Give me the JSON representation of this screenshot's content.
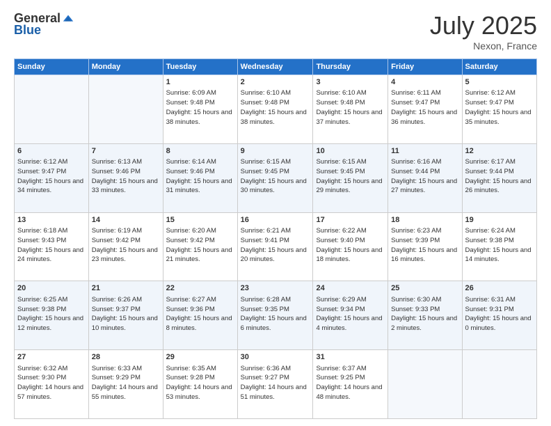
{
  "header": {
    "logo_general": "General",
    "logo_blue": "Blue",
    "month_year": "July 2025",
    "location": "Nexon, France"
  },
  "weekdays": [
    "Sunday",
    "Monday",
    "Tuesday",
    "Wednesday",
    "Thursday",
    "Friday",
    "Saturday"
  ],
  "weeks": [
    [
      {
        "day": "",
        "sunrise": "",
        "sunset": "",
        "daylight": ""
      },
      {
        "day": "",
        "sunrise": "",
        "sunset": "",
        "daylight": ""
      },
      {
        "day": "1",
        "sunrise": "Sunrise: 6:09 AM",
        "sunset": "Sunset: 9:48 PM",
        "daylight": "Daylight: 15 hours and 38 minutes."
      },
      {
        "day": "2",
        "sunrise": "Sunrise: 6:10 AM",
        "sunset": "Sunset: 9:48 PM",
        "daylight": "Daylight: 15 hours and 38 minutes."
      },
      {
        "day": "3",
        "sunrise": "Sunrise: 6:10 AM",
        "sunset": "Sunset: 9:48 PM",
        "daylight": "Daylight: 15 hours and 37 minutes."
      },
      {
        "day": "4",
        "sunrise": "Sunrise: 6:11 AM",
        "sunset": "Sunset: 9:47 PM",
        "daylight": "Daylight: 15 hours and 36 minutes."
      },
      {
        "day": "5",
        "sunrise": "Sunrise: 6:12 AM",
        "sunset": "Sunset: 9:47 PM",
        "daylight": "Daylight: 15 hours and 35 minutes."
      }
    ],
    [
      {
        "day": "6",
        "sunrise": "Sunrise: 6:12 AM",
        "sunset": "Sunset: 9:47 PM",
        "daylight": "Daylight: 15 hours and 34 minutes."
      },
      {
        "day": "7",
        "sunrise": "Sunrise: 6:13 AM",
        "sunset": "Sunset: 9:46 PM",
        "daylight": "Daylight: 15 hours and 33 minutes."
      },
      {
        "day": "8",
        "sunrise": "Sunrise: 6:14 AM",
        "sunset": "Sunset: 9:46 PM",
        "daylight": "Daylight: 15 hours and 31 minutes."
      },
      {
        "day": "9",
        "sunrise": "Sunrise: 6:15 AM",
        "sunset": "Sunset: 9:45 PM",
        "daylight": "Daylight: 15 hours and 30 minutes."
      },
      {
        "day": "10",
        "sunrise": "Sunrise: 6:15 AM",
        "sunset": "Sunset: 9:45 PM",
        "daylight": "Daylight: 15 hours and 29 minutes."
      },
      {
        "day": "11",
        "sunrise": "Sunrise: 6:16 AM",
        "sunset": "Sunset: 9:44 PM",
        "daylight": "Daylight: 15 hours and 27 minutes."
      },
      {
        "day": "12",
        "sunrise": "Sunrise: 6:17 AM",
        "sunset": "Sunset: 9:44 PM",
        "daylight": "Daylight: 15 hours and 26 minutes."
      }
    ],
    [
      {
        "day": "13",
        "sunrise": "Sunrise: 6:18 AM",
        "sunset": "Sunset: 9:43 PM",
        "daylight": "Daylight: 15 hours and 24 minutes."
      },
      {
        "day": "14",
        "sunrise": "Sunrise: 6:19 AM",
        "sunset": "Sunset: 9:42 PM",
        "daylight": "Daylight: 15 hours and 23 minutes."
      },
      {
        "day": "15",
        "sunrise": "Sunrise: 6:20 AM",
        "sunset": "Sunset: 9:42 PM",
        "daylight": "Daylight: 15 hours and 21 minutes."
      },
      {
        "day": "16",
        "sunrise": "Sunrise: 6:21 AM",
        "sunset": "Sunset: 9:41 PM",
        "daylight": "Daylight: 15 hours and 20 minutes."
      },
      {
        "day": "17",
        "sunrise": "Sunrise: 6:22 AM",
        "sunset": "Sunset: 9:40 PM",
        "daylight": "Daylight: 15 hours and 18 minutes."
      },
      {
        "day": "18",
        "sunrise": "Sunrise: 6:23 AM",
        "sunset": "Sunset: 9:39 PM",
        "daylight": "Daylight: 15 hours and 16 minutes."
      },
      {
        "day": "19",
        "sunrise": "Sunrise: 6:24 AM",
        "sunset": "Sunset: 9:38 PM",
        "daylight": "Daylight: 15 hours and 14 minutes."
      }
    ],
    [
      {
        "day": "20",
        "sunrise": "Sunrise: 6:25 AM",
        "sunset": "Sunset: 9:38 PM",
        "daylight": "Daylight: 15 hours and 12 minutes."
      },
      {
        "day": "21",
        "sunrise": "Sunrise: 6:26 AM",
        "sunset": "Sunset: 9:37 PM",
        "daylight": "Daylight: 15 hours and 10 minutes."
      },
      {
        "day": "22",
        "sunrise": "Sunrise: 6:27 AM",
        "sunset": "Sunset: 9:36 PM",
        "daylight": "Daylight: 15 hours and 8 minutes."
      },
      {
        "day": "23",
        "sunrise": "Sunrise: 6:28 AM",
        "sunset": "Sunset: 9:35 PM",
        "daylight": "Daylight: 15 hours and 6 minutes."
      },
      {
        "day": "24",
        "sunrise": "Sunrise: 6:29 AM",
        "sunset": "Sunset: 9:34 PM",
        "daylight": "Daylight: 15 hours and 4 minutes."
      },
      {
        "day": "25",
        "sunrise": "Sunrise: 6:30 AM",
        "sunset": "Sunset: 9:33 PM",
        "daylight": "Daylight: 15 hours and 2 minutes."
      },
      {
        "day": "26",
        "sunrise": "Sunrise: 6:31 AM",
        "sunset": "Sunset: 9:31 PM",
        "daylight": "Daylight: 15 hours and 0 minutes."
      }
    ],
    [
      {
        "day": "27",
        "sunrise": "Sunrise: 6:32 AM",
        "sunset": "Sunset: 9:30 PM",
        "daylight": "Daylight: 14 hours and 57 minutes."
      },
      {
        "day": "28",
        "sunrise": "Sunrise: 6:33 AM",
        "sunset": "Sunset: 9:29 PM",
        "daylight": "Daylight: 14 hours and 55 minutes."
      },
      {
        "day": "29",
        "sunrise": "Sunrise: 6:35 AM",
        "sunset": "Sunset: 9:28 PM",
        "daylight": "Daylight: 14 hours and 53 minutes."
      },
      {
        "day": "30",
        "sunrise": "Sunrise: 6:36 AM",
        "sunset": "Sunset: 9:27 PM",
        "daylight": "Daylight: 14 hours and 51 minutes."
      },
      {
        "day": "31",
        "sunrise": "Sunrise: 6:37 AM",
        "sunset": "Sunset: 9:25 PM",
        "daylight": "Daylight: 14 hours and 48 minutes."
      },
      {
        "day": "",
        "sunrise": "",
        "sunset": "",
        "daylight": ""
      },
      {
        "day": "",
        "sunrise": "",
        "sunset": "",
        "daylight": ""
      }
    ]
  ]
}
